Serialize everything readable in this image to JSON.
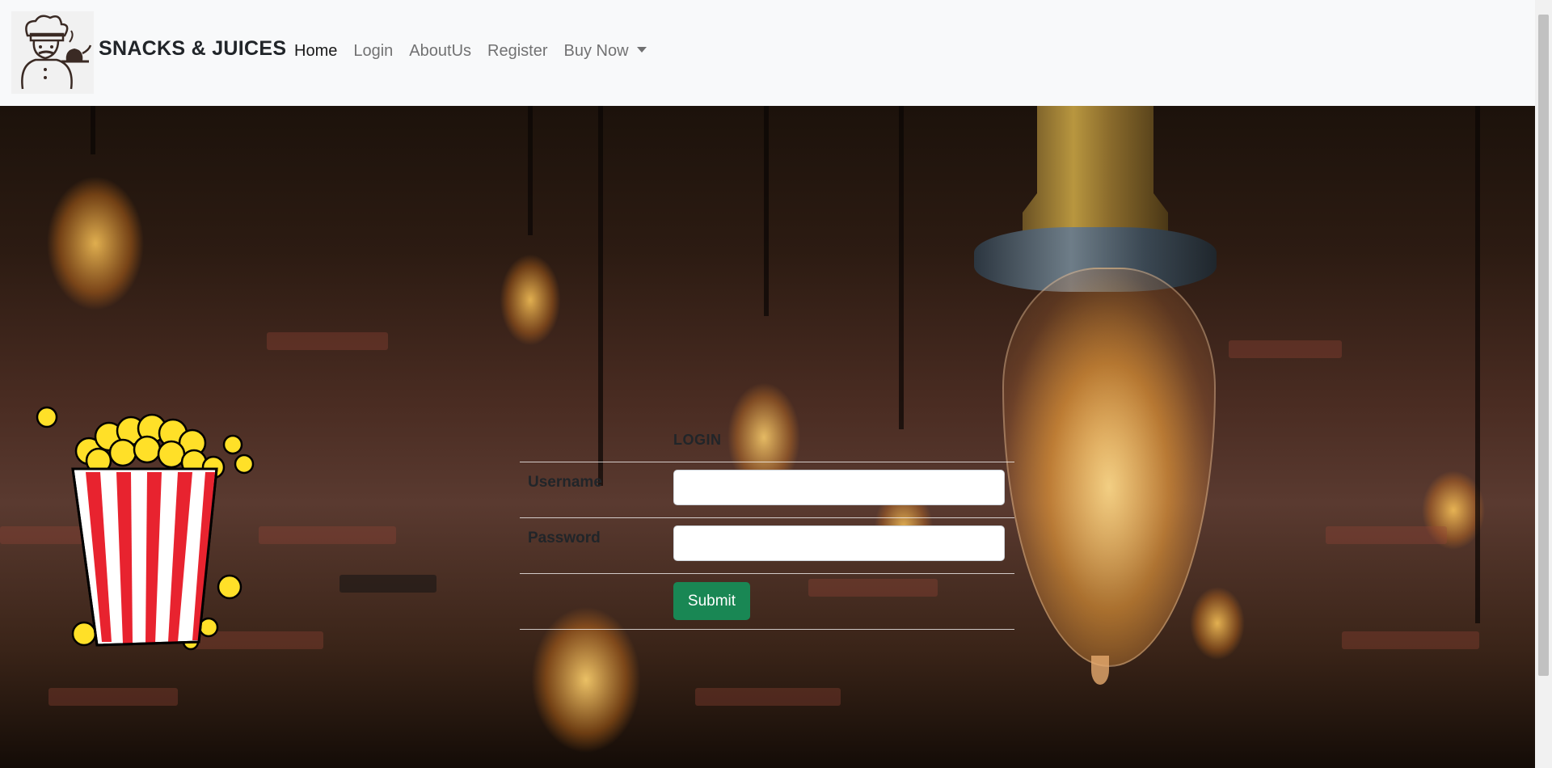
{
  "brand": {
    "name": "SNACKS & JUICES",
    "logo_icon": "chef-logo-icon"
  },
  "nav": {
    "items": [
      {
        "label": "Home",
        "active": true
      },
      {
        "label": "Login",
        "active": false
      },
      {
        "label": "AboutUs",
        "active": false
      },
      {
        "label": "Register",
        "active": false
      },
      {
        "label": "Buy Now",
        "active": false,
        "dropdown": true
      }
    ]
  },
  "login": {
    "title": "LOGIN",
    "username_label": "Username",
    "username_value": "",
    "password_label": "Password",
    "password_value": "",
    "submit_label": "Submit"
  },
  "decor": {
    "popcorn_icon": "popcorn-bucket-icon",
    "background": "edison-bulbs-brick-wall"
  },
  "colors": {
    "navbar_bg": "#f8f9fa",
    "submit_bg": "#198754",
    "popcorn_red": "#e8232f",
    "popcorn_yellow": "#ffe028"
  }
}
